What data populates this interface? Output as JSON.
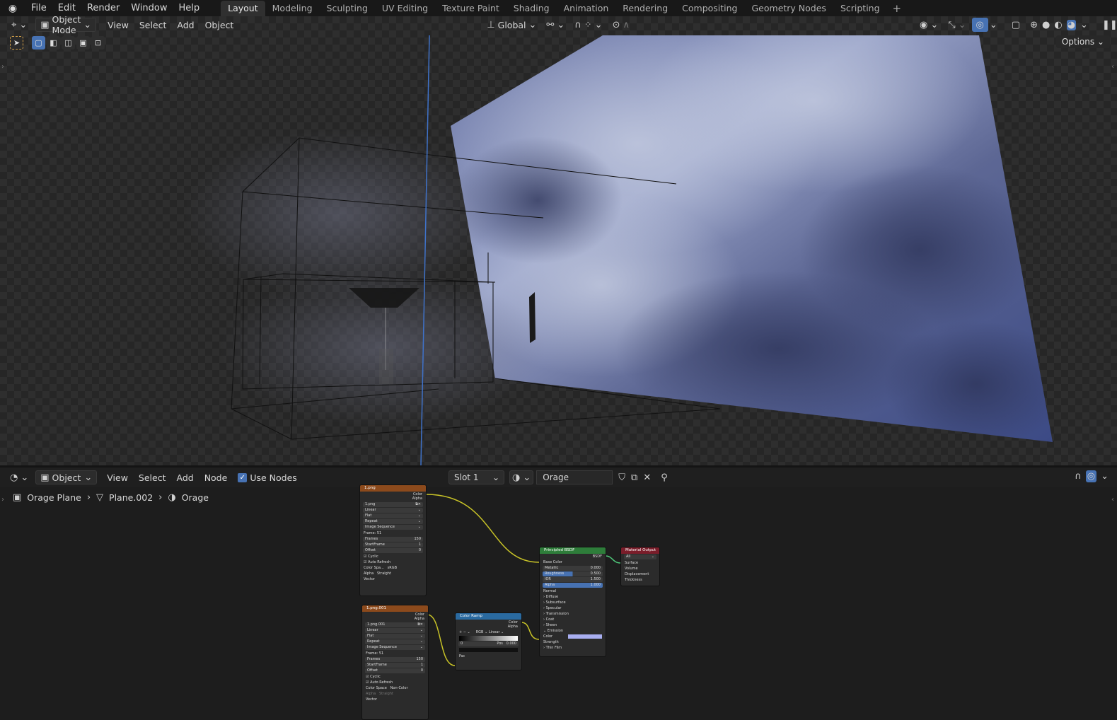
{
  "topbar": {
    "menus": [
      "File",
      "Edit",
      "Render",
      "Window",
      "Help"
    ],
    "workspaces": [
      "Layout",
      "Modeling",
      "Sculpting",
      "UV Editing",
      "Texture Paint",
      "Shading",
      "Animation",
      "Rendering",
      "Compositing",
      "Geometry Nodes",
      "Scripting"
    ],
    "active_workspace": "Layout",
    "add_tab": "+"
  },
  "viewport": {
    "mode": "Object Mode",
    "menus": [
      "View",
      "Select",
      "Add",
      "Object"
    ],
    "transform_orientation": "Global",
    "options": "Options"
  },
  "node_editor": {
    "type": "Object",
    "menus": [
      "View",
      "Select",
      "Add",
      "Node"
    ],
    "use_nodes_label": "Use Nodes",
    "slot": "Slot 1",
    "material": "Orage",
    "breadcrumb": [
      "Orage Plane",
      "Plane.002",
      "Orage"
    ],
    "nodes": {
      "img1": {
        "title": "1.png",
        "out_color": "Color",
        "out_alpha": "Alpha",
        "image": "1.png",
        "interp": "Linear",
        "proj": "Flat",
        "ext": "Repeat",
        "source": "Image Sequence",
        "frame": "Frame: 51",
        "frames_label": "Frames",
        "frames": "150",
        "start_label": "StartFrame",
        "start": "1",
        "offset_label": "Offset",
        "offset": "0",
        "cyclic": "Cyclic",
        "auto": "Auto Refresh",
        "cs_label": "Color Spa...",
        "cs": "sRGB",
        "alpha_label": "Alpha",
        "alpha": "Straight",
        "vector": "Vector"
      },
      "img2": {
        "title": "1.png.001",
        "out_color": "Color",
        "out_alpha": "Alpha",
        "image": "1.png.001",
        "interp": "Linear",
        "proj": "Flat",
        "ext": "Repeat",
        "source": "Image Sequence",
        "frame": "Frame: 51",
        "frames_label": "Frames",
        "frames": "150",
        "start_label": "StartFrame",
        "start": "1",
        "offset_label": "Offset",
        "offset": "0",
        "cyclic": "Cyclic",
        "auto": "Auto Refresh",
        "cs_label": "Color Space",
        "cs": "Non-Color",
        "alpha_label": "Alpha",
        "alpha": "Straight",
        "vector": "Vector"
      },
      "ramp": {
        "title": "Color Ramp",
        "out_color": "Color",
        "out_alpha": "Alpha",
        "mode": "RGB",
        "interp": "Linear",
        "index": "0",
        "pos_label": "Pos",
        "pos": "0.000",
        "fac": "Fac"
      },
      "bsdf": {
        "title": "Principled BSDF",
        "out": "BSDF",
        "base_color": "Base Color",
        "metallic_label": "Metallic",
        "metallic": "0.000",
        "roughness_label": "Roughness",
        "roughness": "0.500",
        "ior_label": "IOR",
        "ior": "1.500",
        "alpha_label": "Alpha",
        "alpha": "1.000",
        "normal": "Normal",
        "sections": [
          "Diffuse",
          "Subsurface",
          "Specular",
          "Transmission",
          "Coat",
          "Sheen",
          "Emission"
        ],
        "em_color": "Color",
        "em_strength": "Strength",
        "thin_film": "Thin Film"
      },
      "output": {
        "title": "Material Output",
        "target": "All",
        "inputs": [
          "Surface",
          "Volume",
          "Displacement",
          "Thickness"
        ]
      }
    }
  }
}
